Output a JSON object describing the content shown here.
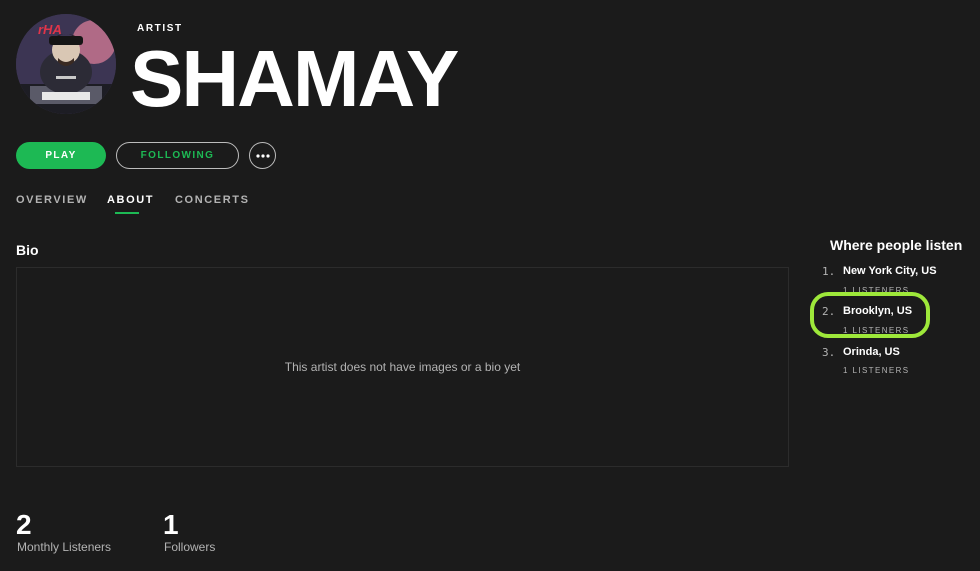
{
  "artist": {
    "type_label": "ARTIST",
    "name": "SHAMAY"
  },
  "actions": {
    "play_label": "PLAY",
    "follow_label": "FOLLOWING",
    "more_icon": "more-horizontal-icon"
  },
  "tabs": [
    {
      "label": "OVERVIEW",
      "active": false
    },
    {
      "label": "ABOUT",
      "active": true
    },
    {
      "label": "CONCERTS",
      "active": false
    }
  ],
  "bio": {
    "heading": "Bio",
    "empty_text": "This artist does not have images or a bio yet"
  },
  "stats": [
    {
      "value": "2",
      "label": "Monthly Listeners"
    },
    {
      "value": "1",
      "label": "Followers"
    }
  ],
  "where_people_listen": {
    "heading": "Where people listen",
    "locations": [
      {
        "rank": "1.",
        "city": "New York City, US",
        "listeners": "1 LISTENERS"
      },
      {
        "rank": "2.",
        "city": "Brooklyn, US",
        "listeners": "1 LISTENERS",
        "highlighted": true
      },
      {
        "rank": "3.",
        "city": "Orinda, US",
        "listeners": "1 LISTENERS"
      }
    ]
  },
  "colors": {
    "accent": "#1db954",
    "background": "#1b1b1b",
    "highlight": "#9ee83a"
  }
}
